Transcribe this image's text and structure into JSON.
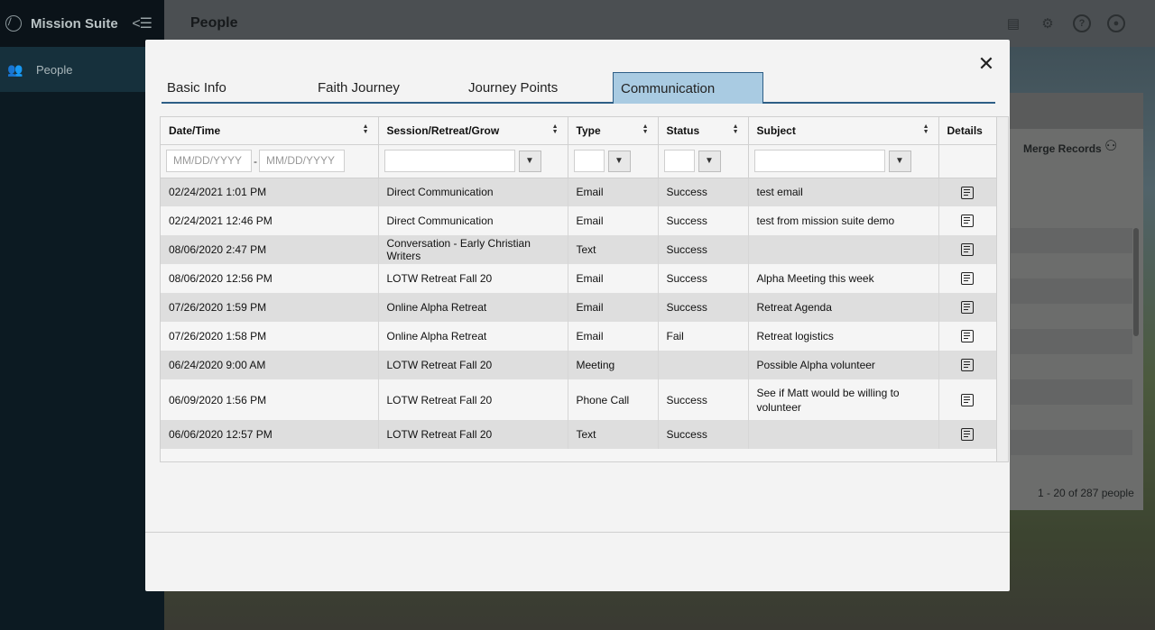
{
  "app": {
    "title": "Mission Suite"
  },
  "sidebar": {
    "items": [
      {
        "label": "People",
        "icon": "people-icon"
      }
    ]
  },
  "header": {
    "page_title": "People"
  },
  "background_panel": {
    "merge_label": "Merge Records",
    "count": "1 - 20 of 287 people"
  },
  "modal": {
    "tabs": [
      {
        "label": "Basic Info",
        "active": false
      },
      {
        "label": "Faith Journey",
        "active": false
      },
      {
        "label": "Journey Points",
        "active": false
      },
      {
        "label": "Communication",
        "active": true
      }
    ],
    "columns": [
      "Date/Time",
      "Session/Retreat/Grow",
      "Type",
      "Status",
      "Subject",
      "Details"
    ],
    "filters": {
      "date_from_placeholder": "MM/DD/YYYY",
      "date_to_placeholder": "MM/DD/YYYY"
    },
    "rows": [
      {
        "datetime": "02/24/2021 1:01 PM",
        "session": "Direct Communication",
        "type": "Email",
        "status": "Success",
        "subject": "test email"
      },
      {
        "datetime": "02/24/2021 12:46 PM",
        "session": "Direct Communication",
        "type": "Email",
        "status": "Success",
        "subject": "test from mission suite demo"
      },
      {
        "datetime": "08/06/2020 2:47 PM",
        "session": "Conversation - Early Christian Writers",
        "type": "Text",
        "status": "Success",
        "subject": ""
      },
      {
        "datetime": "08/06/2020 12:56 PM",
        "session": "LOTW Retreat Fall 20",
        "type": "Email",
        "status": "Success",
        "subject": "Alpha Meeting this week"
      },
      {
        "datetime": "07/26/2020 1:59 PM",
        "session": "Online Alpha Retreat",
        "type": "Email",
        "status": "Success",
        "subject": "Retreat Agenda"
      },
      {
        "datetime": "07/26/2020 1:58 PM",
        "session": "Online Alpha Retreat",
        "type": "Email",
        "status": "Fail",
        "subject": "Retreat logistics"
      },
      {
        "datetime": "06/24/2020 9:00 AM",
        "session": "LOTW Retreat Fall 20",
        "type": "Meeting",
        "status": "",
        "subject": "Possible Alpha volunteer"
      },
      {
        "datetime": "06/09/2020 1:56 PM",
        "session": "LOTW Retreat Fall 20",
        "type": "Phone Call",
        "status": "Success",
        "subject": "See if Matt would be willing to volunteer"
      },
      {
        "datetime": "06/06/2020 12:57 PM",
        "session": "LOTW Retreat Fall 20",
        "type": "Text",
        "status": "Success",
        "subject": ""
      }
    ]
  },
  "colors": {
    "active_tab": "#a9cbe2",
    "tab_border": "#2d5e86",
    "sidebar": "#0c1a22"
  }
}
